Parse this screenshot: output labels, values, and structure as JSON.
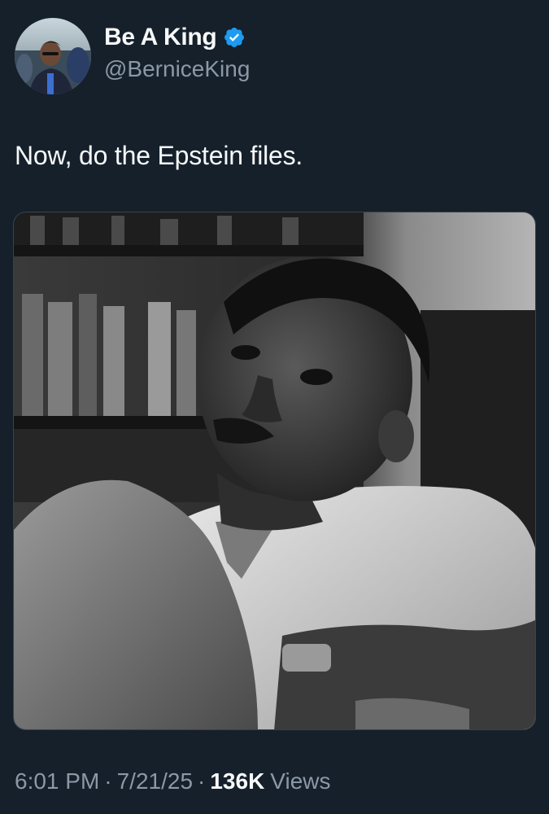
{
  "author": {
    "display_name": "Be A King",
    "handle": "@BerniceKing",
    "verified": true,
    "avatar_icon": "profile-photo"
  },
  "tweet": {
    "text": "Now, do the Epstein files.",
    "media_icon": "black-and-white-photo-of-man-at-desk"
  },
  "meta": {
    "time": "6:01 PM",
    "separator": "·",
    "date": "7/21/25",
    "views_count": "136K",
    "views_label": "Views"
  },
  "colors": {
    "background": "#15202b",
    "text_primary": "#f7f9f9",
    "text_secondary": "#8b98a5",
    "verified_blue": "#1d9bf0"
  }
}
